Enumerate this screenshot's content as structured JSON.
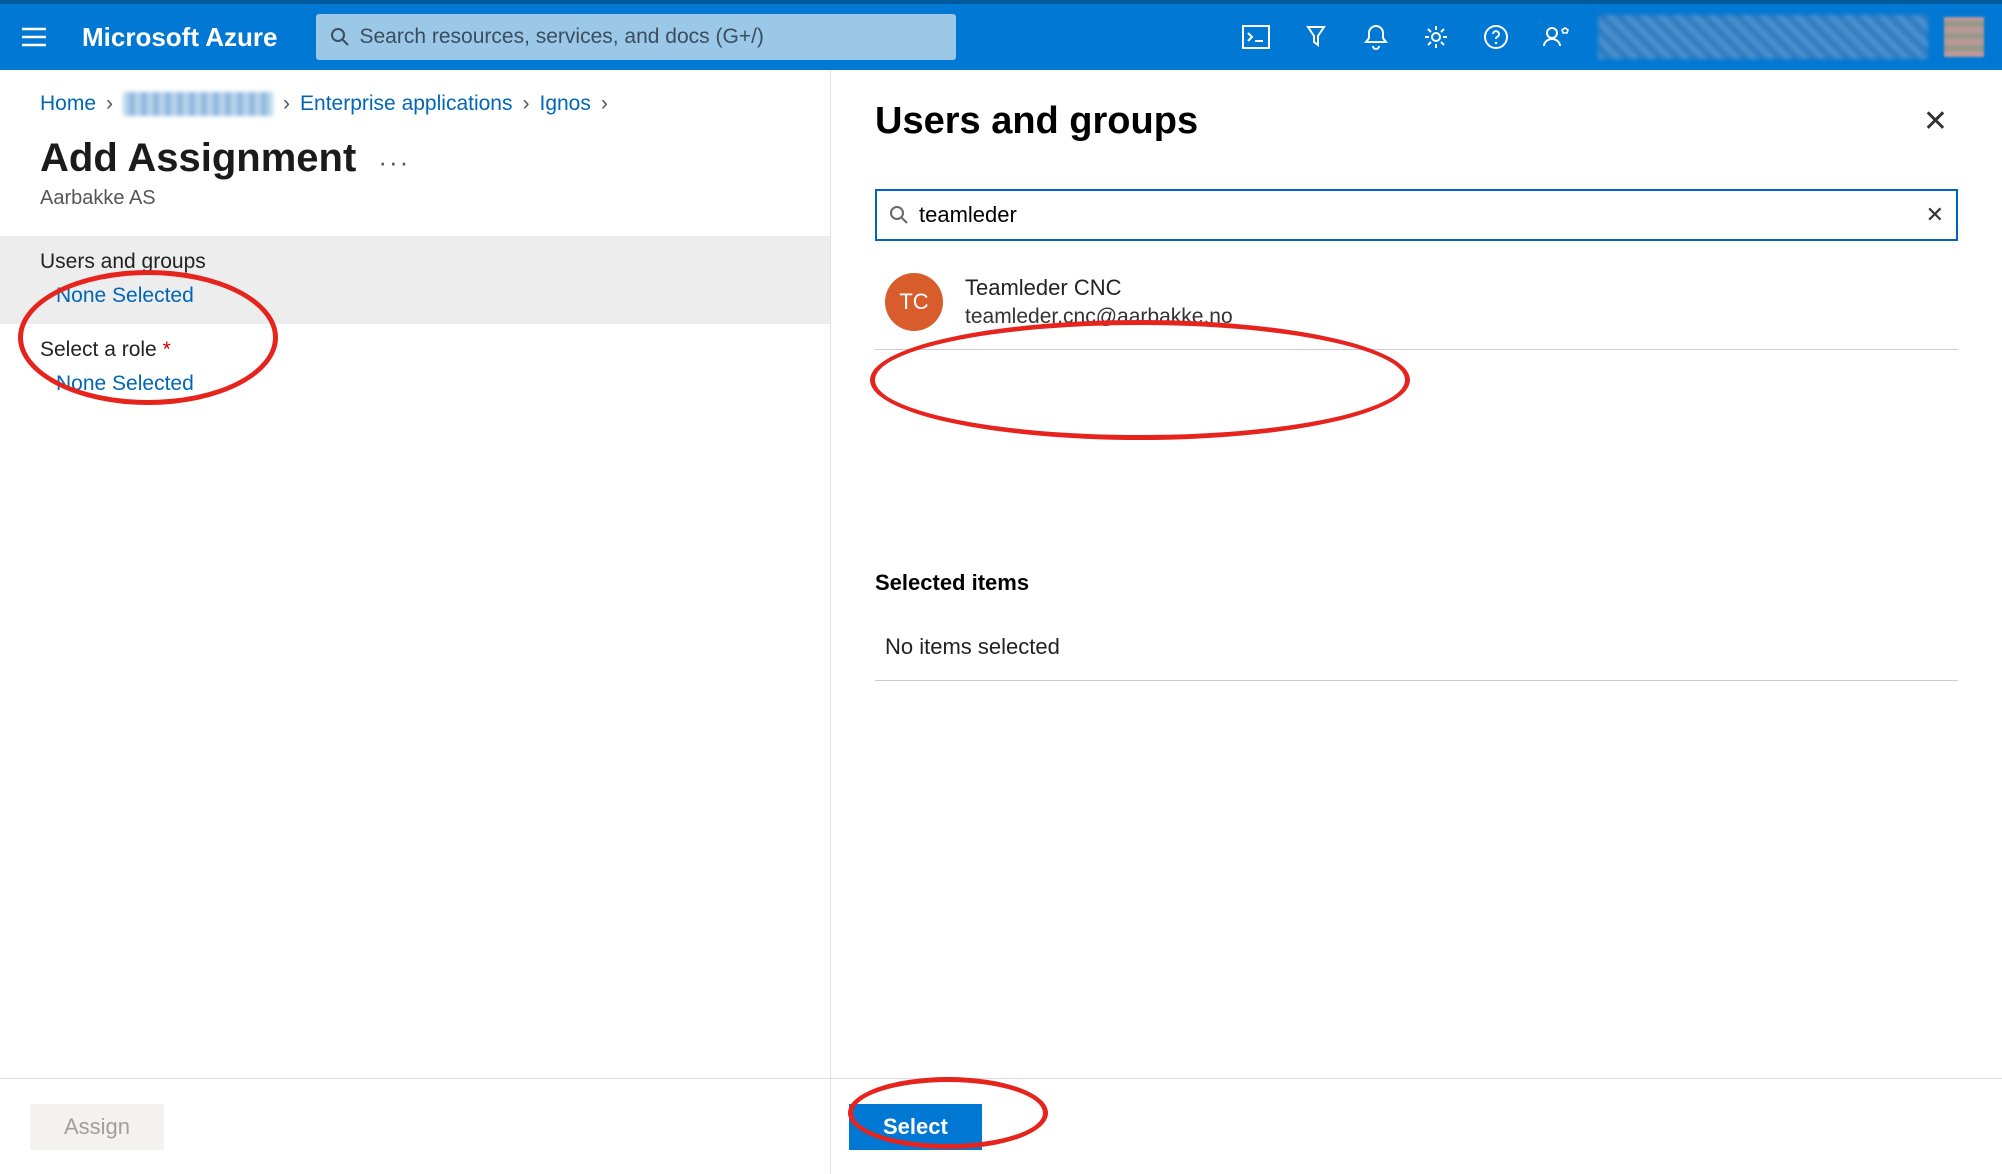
{
  "topbar": {
    "brand": "Microsoft Azure",
    "search_placeholder": "Search resources, services, and docs (G+/)"
  },
  "breadcrumb": {
    "home": "Home",
    "ent_apps": "Enterprise applications",
    "app_name": "Ignos"
  },
  "left": {
    "title": "Add Assignment",
    "subtitle": "Aarbakke AS",
    "users_groups_label": "Users and groups",
    "users_groups_value": "None Selected",
    "role_label": "Select a role",
    "role_value": "None Selected",
    "assign_button": "Assign"
  },
  "panel": {
    "title": "Users and groups",
    "search_value": "teamleder",
    "result": {
      "initials": "TC",
      "name": "Teamleder CNC",
      "email": "teamleder.cnc@aarbakke.no"
    },
    "selected_items_header": "Selected items",
    "no_items": "No items selected",
    "select_button": "Select"
  }
}
